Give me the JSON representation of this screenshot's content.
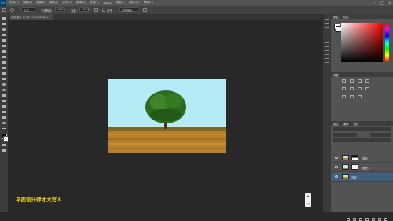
{
  "app": {
    "logo": "Ps"
  },
  "menu": {
    "items": [
      "文件(F)",
      "编辑(E)",
      "图像(I)",
      "图层(L)",
      "文字(Y)",
      "选择(S)",
      "滤镜(T)",
      "3D(D)",
      "视图(V)",
      "窗口(W)",
      "帮助(H)"
    ]
  },
  "window_controls": {
    "minimize": "–",
    "maximize": "□",
    "close": "×"
  },
  "options_bar": {
    "mode_value": "正常",
    "opacity_label": "不透明度:",
    "opacity_value": "100%",
    "flow_label": "流量:",
    "flow_value": "100%",
    "align_label": "对齐",
    "sample_value": "当前图层"
  },
  "document_tab": {
    "title": "未标题-1 @ 66.7% (RGB/8#) *"
  },
  "canvas": {
    "watermark": "平面设计师才大官人"
  },
  "panels": {
    "color_tab": "颜色",
    "swatches_tab": "色板",
    "adjust_tab": "调整",
    "layers_tab": "图层",
    "channels_tab": "通道",
    "paths_tab": "路径",
    "layer_names": [
      "草地",
      "图层 1",
      "背景"
    ]
  },
  "colors": {
    "accent_yellow": "#f6d31a",
    "sky": "#b6ebf5",
    "grass": "#b9802c",
    "tree": "#2d6a1e"
  }
}
